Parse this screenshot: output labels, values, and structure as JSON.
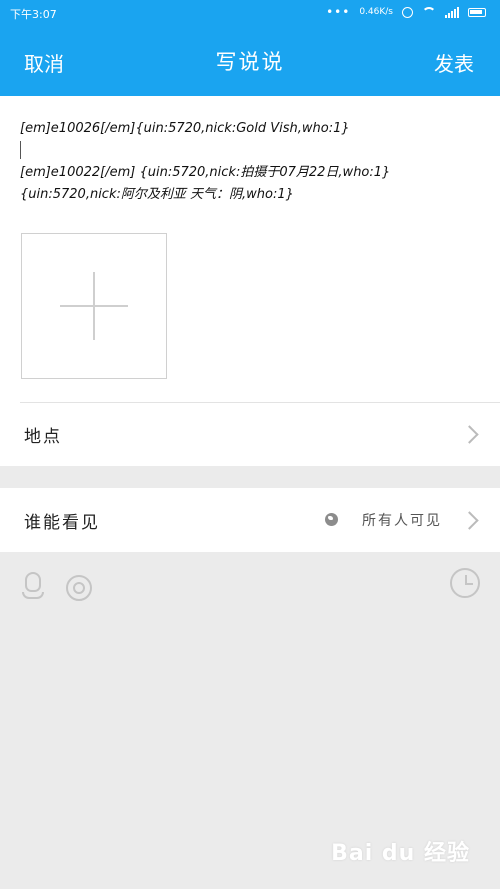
{
  "status_bar": {
    "time": "下午3:07",
    "net_speed": "0.46K/s"
  },
  "nav": {
    "cancel": "取消",
    "title": "写说说",
    "send": "发表"
  },
  "post": {
    "lines": [
      "[em]e10026[/em]{uin:5720,nick:Gold Vish,who:1}",
      "",
      "[em]e10022[/em] {uin:5720,nick:拍摄于07月22日,who:1}",
      "{uin:5720,nick:阿尔及利亚 天气：阴,who:1}"
    ]
  },
  "location": {
    "label": "地点"
  },
  "visibility": {
    "label": "谁能看见",
    "value": "所有人可见"
  },
  "icons": {
    "qq": "qq-penguin-icon",
    "aperture": "aperture-icon",
    "clock": "clock-icon",
    "globe": "globe-icon",
    "chevron": "chevron-right-icon"
  },
  "colors": {
    "brand": "#1aa4f0",
    "background": "#ebebeb"
  },
  "watermark": "Bai du 经验"
}
